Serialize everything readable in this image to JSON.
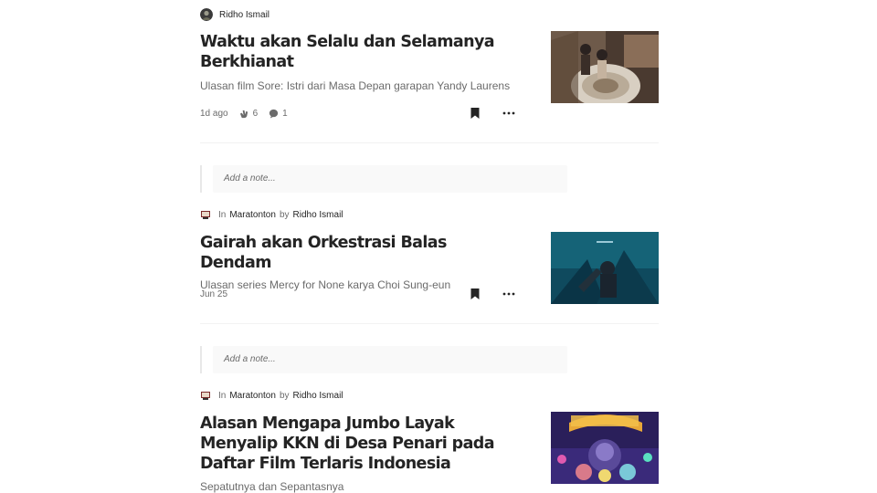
{
  "articles": [
    {
      "author": "Ridho Ismail",
      "publication": "",
      "in_label": "",
      "by_label": "",
      "title": "Waktu akan Selalu dan Selamanya Berkhianat",
      "subtitle": "Ulasan film Sore: Istri dari Masa Depan garapan Yandy Laurens",
      "date": "1d ago",
      "claps": "6",
      "responses": "1"
    },
    {
      "author": "Ridho Ismail",
      "publication": "Maratonton",
      "in_label": "In",
      "by_label": "by",
      "title": "Gairah akan Orkestrasi Balas Dendam",
      "subtitle": "Ulasan series Mercy for None karya Choi Sung-eun",
      "date": "Jun 25",
      "note_placeholder": "Add a note..."
    },
    {
      "author": "Ridho Ismail",
      "publication": "Maratonton",
      "in_label": "In",
      "by_label": "by",
      "title": "Alasan Mengapa Jumbo Layak Menyalip KKN di Desa Penari pada Daftar Film Terlaris Indonesia",
      "subtitle": "Sepatutnya dan Sepantasnya",
      "note_placeholder": "Add a note..."
    }
  ],
  "icons": {
    "clap": "clap-icon",
    "response": "response-icon",
    "bookmark": "bookmark-icon",
    "more": "more-icon"
  },
  "colors": {
    "text": "#242424",
    "muted": "#6b6b6b",
    "divider": "#f2f2f2"
  }
}
